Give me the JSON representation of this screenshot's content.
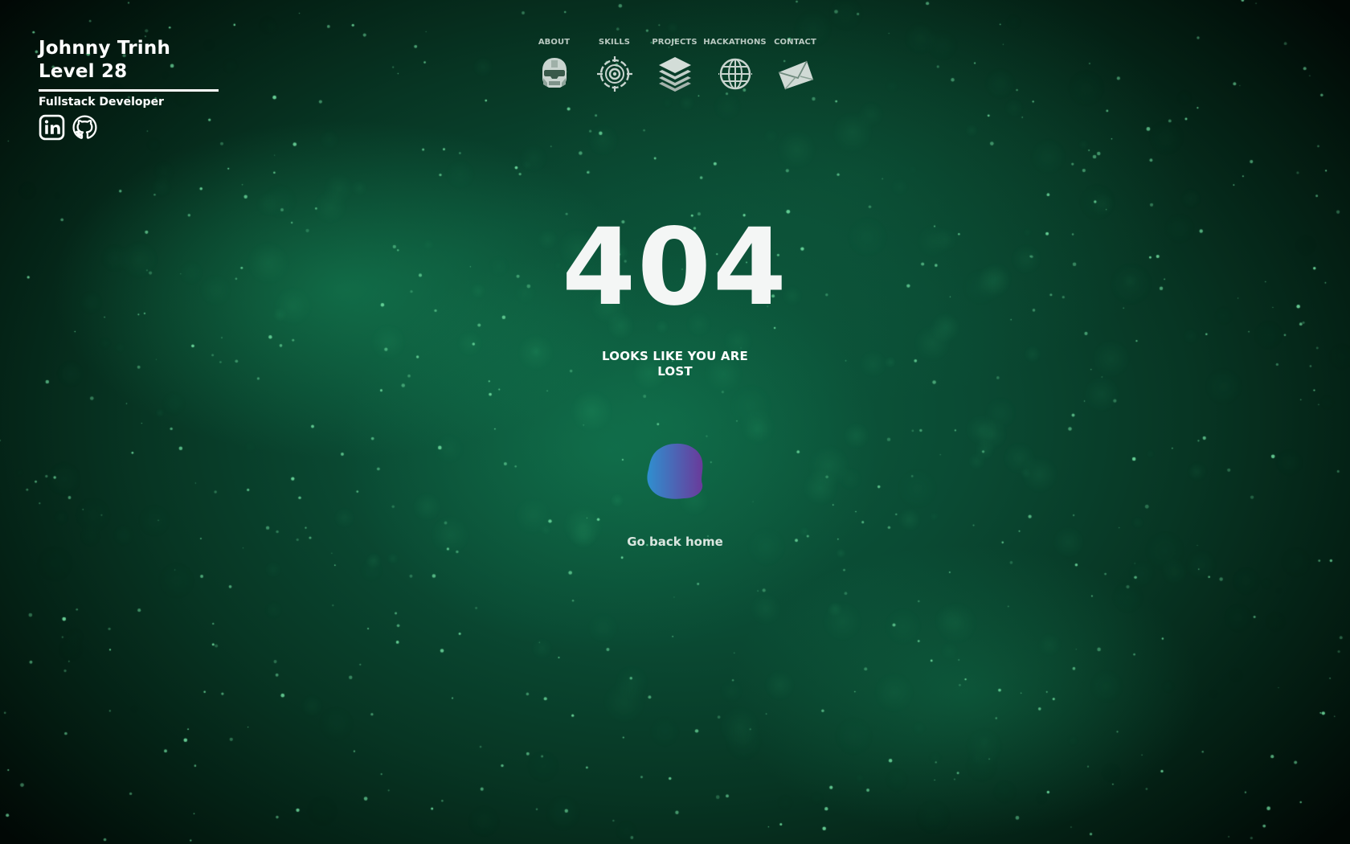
{
  "profile": {
    "name": "Johnny Trinh",
    "level": "Level 28",
    "role": "Fullstack Developer"
  },
  "socials": [
    {
      "icon": "linkedin-icon"
    },
    {
      "icon": "github-icon"
    }
  ],
  "nav": {
    "items": [
      {
        "label": "ABOUT",
        "icon": "helmet-icon"
      },
      {
        "label": "SKILLS",
        "icon": "target-icon"
      },
      {
        "label": "PROJECTS",
        "icon": "layers-icon"
      },
      {
        "label": "HACKATHONS",
        "icon": "globe-icon"
      },
      {
        "label": "CONTACT",
        "icon": "envelope-icon"
      }
    ]
  },
  "error": {
    "code": "404",
    "message": "LOOKS LIKE YOU ARE LOST",
    "link": "Go back home"
  },
  "colors": {
    "background": "#0a4a33",
    "text": "#ffffff",
    "nav_text": "#b9c9c1",
    "blob_start": "#2f8fcf",
    "blob_end": "#6a3a9a"
  }
}
